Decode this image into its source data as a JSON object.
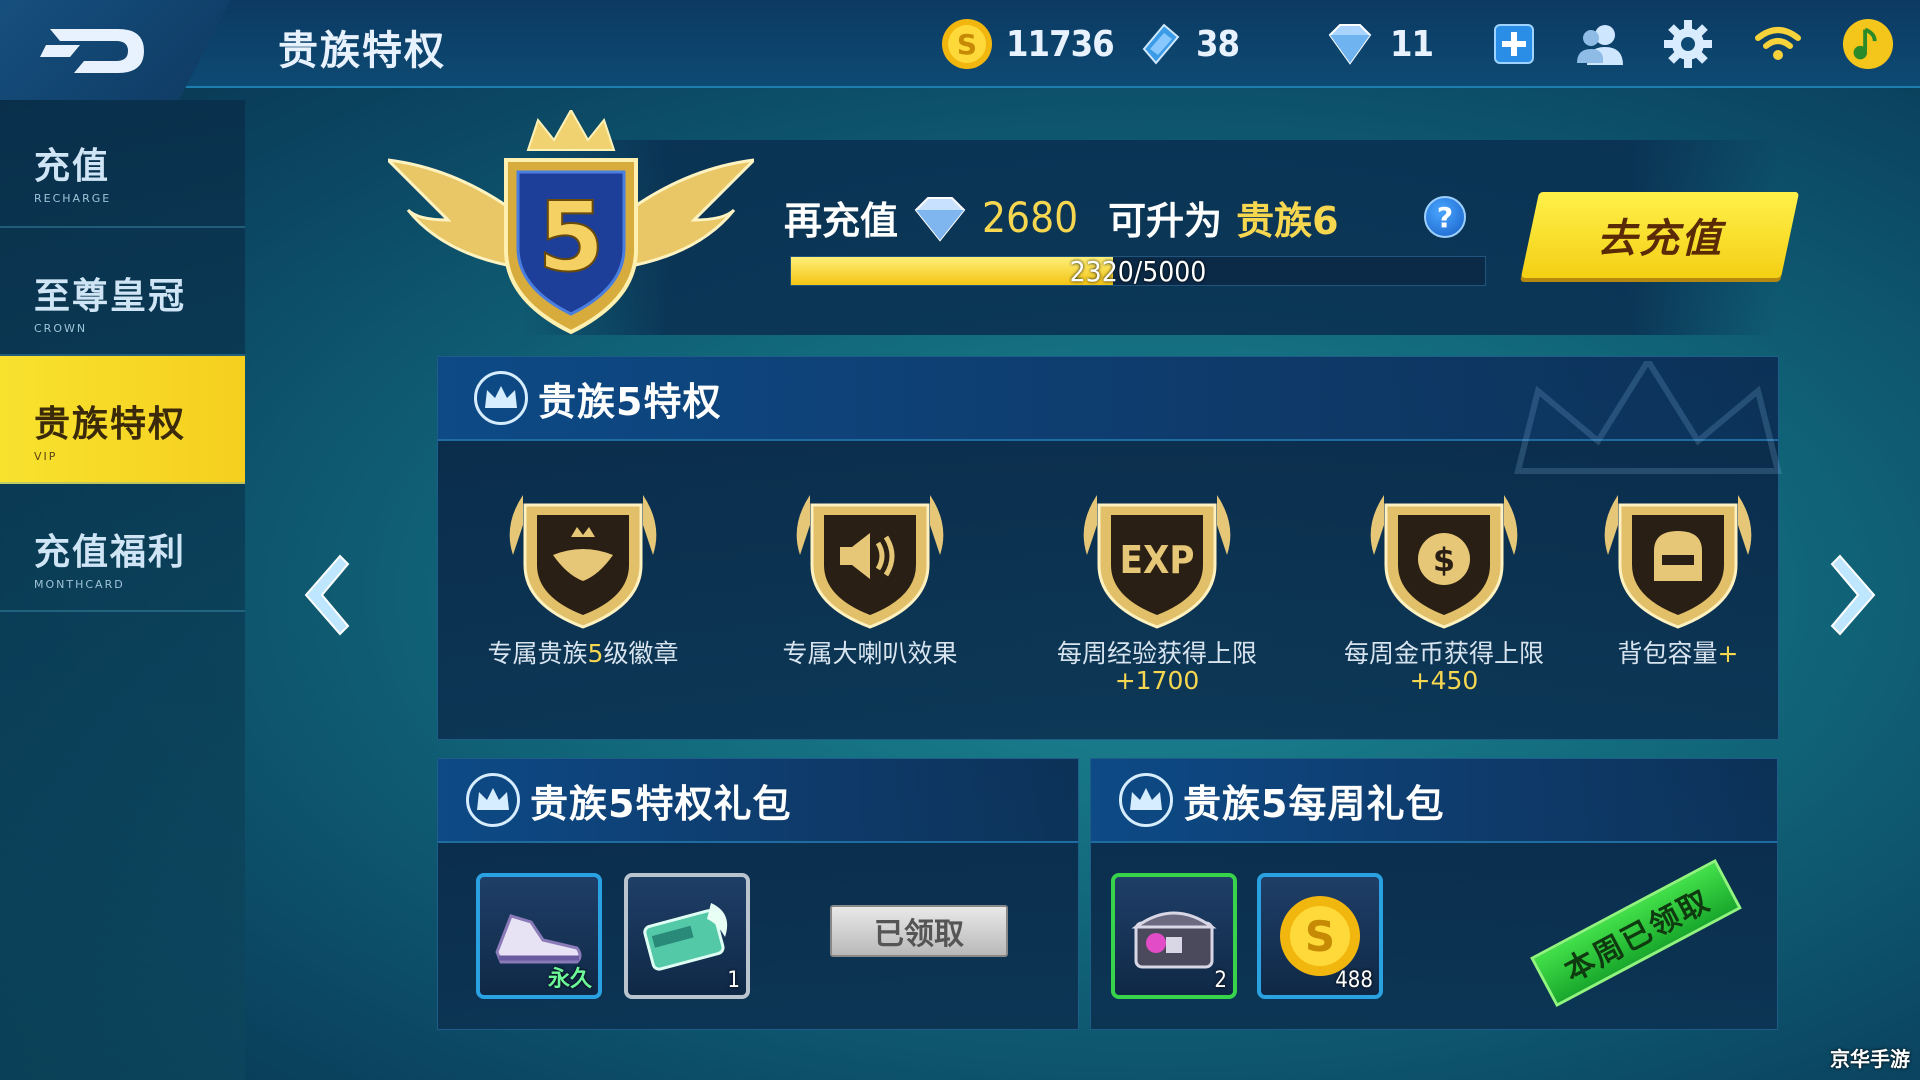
{
  "header": {
    "title": "贵族特权",
    "resources": {
      "coins": "11736",
      "gems": "38",
      "diamonds": "11"
    }
  },
  "sidebar": {
    "items": [
      {
        "label": "充值",
        "sub": "RECHARGE",
        "active": false
      },
      {
        "label": "至尊皇冠",
        "sub": "CROWN",
        "active": false
      },
      {
        "label": "贵族特权",
        "sub": "VIP",
        "active": true
      },
      {
        "label": "充值福利",
        "sub": "MONTHCARD",
        "active": false
      }
    ]
  },
  "vip": {
    "level": "5",
    "recharge_label": "再充值",
    "recharge_amount": "2680",
    "upgrade_label": "可升为",
    "next_level": "贵族6",
    "help": "?",
    "progress_text": "2320/5000",
    "progress_fraction": 0.464,
    "go_button": "去充值"
  },
  "privileges": {
    "title": "贵族5特权",
    "items": [
      {
        "icon": "winged-emblem-icon",
        "text_a": "专属贵族",
        "hl": "5",
        "text_b": "级徽章"
      },
      {
        "icon": "speaker-icon",
        "text_a": "专属大喇叭效果",
        "hl": "",
        "text_b": ""
      },
      {
        "icon": "exp-icon",
        "text_a": "每周经验获得上限",
        "hl": "+1700",
        "text_b": ""
      },
      {
        "icon": "coin-dollar-icon",
        "text_a": "每周金币获得上限",
        "hl": "+450",
        "text_b": ""
      },
      {
        "icon": "backpack-icon",
        "text_a": "背包容量",
        "hl": "+",
        "text_b": ""
      }
    ]
  },
  "gift_vip": {
    "title": "贵族5特权礼包",
    "items": [
      {
        "icon": "sneaker-icon",
        "badge": "永久"
      },
      {
        "icon": "rename-card-icon",
        "count": "1"
      }
    ],
    "claimed_label": "已领取"
  },
  "gift_week": {
    "title": "贵族5每周礼包",
    "items": [
      {
        "icon": "treasure-chest-icon",
        "count": "2"
      },
      {
        "icon": "gold-coin-icon",
        "count": "488"
      }
    ],
    "claimed_stamp": "本周已领取"
  },
  "watermark": "京华手游",
  "colors": {
    "accent_yellow": "#f7d650",
    "active_tab": "#f6cf1e",
    "panel": "#0c3a62",
    "stamp_green": "#2fc43a"
  }
}
